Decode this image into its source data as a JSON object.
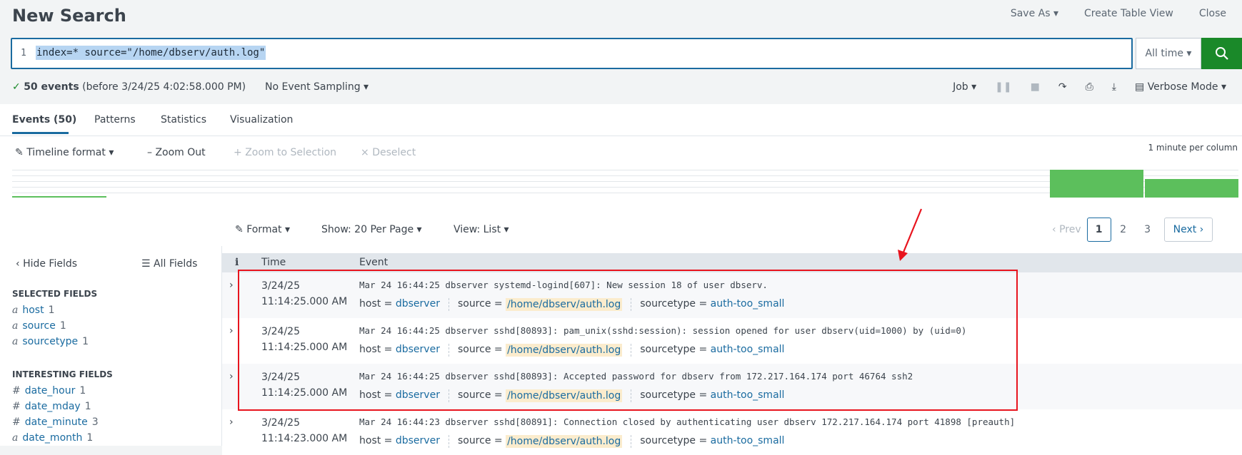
{
  "header": {
    "title": "New Search",
    "save_as": "Save As",
    "create_table_view": "Create Table View",
    "close": "Close"
  },
  "search": {
    "line_number": "1",
    "query": "index=* source=\"/home/dbserv/auth.log\"",
    "time_range": "All time"
  },
  "status": {
    "events_count": "50 events",
    "before": "(before 3/24/25 4:02:58.000 PM)",
    "sampling": "No Event Sampling",
    "job": "Job",
    "mode": "Verbose Mode"
  },
  "tabs": [
    "Events (50)",
    "Patterns",
    "Statistics",
    "Visualization"
  ],
  "timeline": {
    "format": "Timeline format",
    "zoom_out": "Zoom Out",
    "zoom_selection": "Zoom to Selection",
    "deselect": "Deselect",
    "per_column": "1 minute per column",
    "bar_color": "#5cbf5c"
  },
  "results_controls": {
    "format": "Format",
    "show": "Show: 20 Per Page",
    "view": "View: List",
    "prev": "Prev",
    "pages": [
      "1",
      "2",
      "3"
    ],
    "next": "Next"
  },
  "sidebar": {
    "hide_fields": "Hide Fields",
    "all_fields": "All Fields",
    "selected_title": "SELECTED FIELDS",
    "selected": [
      {
        "type": "a",
        "name": "host",
        "count": "1"
      },
      {
        "type": "a",
        "name": "source",
        "count": "1"
      },
      {
        "type": "a",
        "name": "sourcetype",
        "count": "1"
      }
    ],
    "interesting_title": "INTERESTING FIELDS",
    "interesting": [
      {
        "type": "#",
        "name": "date_hour",
        "count": "1"
      },
      {
        "type": "#",
        "name": "date_mday",
        "count": "1"
      },
      {
        "type": "#",
        "name": "date_minute",
        "count": "3"
      },
      {
        "type": "a",
        "name": "date_month",
        "count": "1"
      }
    ]
  },
  "table": {
    "col_info": "i",
    "col_time": "Time",
    "col_event": "Event",
    "rows": [
      {
        "date": "3/24/25",
        "time": "11:14:25.000 AM",
        "event": "Mar 24 16:44:25 dbserver systemd-logind[607]: New session 18 of user dbserv.",
        "host": "dbserver",
        "source": "/home/dbserv/auth.log",
        "sourcetype": "auth-too_small"
      },
      {
        "date": "3/24/25",
        "time": "11:14:25.000 AM",
        "event": "Mar 24 16:44:25 dbserver sshd[80893]: pam_unix(sshd:session): session opened for user dbserv(uid=1000) by (uid=0)",
        "host": "dbserver",
        "source": "/home/dbserv/auth.log",
        "sourcetype": "auth-too_small"
      },
      {
        "date": "3/24/25",
        "time": "11:14:25.000 AM",
        "event": "Mar 24 16:44:25 dbserver sshd[80893]: Accepted password for dbserv from 172.217.164.174 port 46764 ssh2",
        "host": "dbserver",
        "source": "/home/dbserv/auth.log",
        "sourcetype": "auth-too_small"
      },
      {
        "date": "3/24/25",
        "time": "11:14:23.000 AM",
        "event": "Mar 24 16:44:23 dbserver sshd[80891]: Connection closed by authenticating user dbserv 172.217.164.174 port 41898 [preauth]",
        "host": "dbserver",
        "source": "/home/dbserv/auth.log",
        "sourcetype": "auth-too_small"
      }
    ],
    "labels": {
      "host": "host =",
      "source": "source =",
      "sourcetype": "sourcetype ="
    }
  },
  "colors": {
    "accent": "#1a6ba0",
    "search_button": "#1a8929",
    "annotation": "#e8141e"
  }
}
